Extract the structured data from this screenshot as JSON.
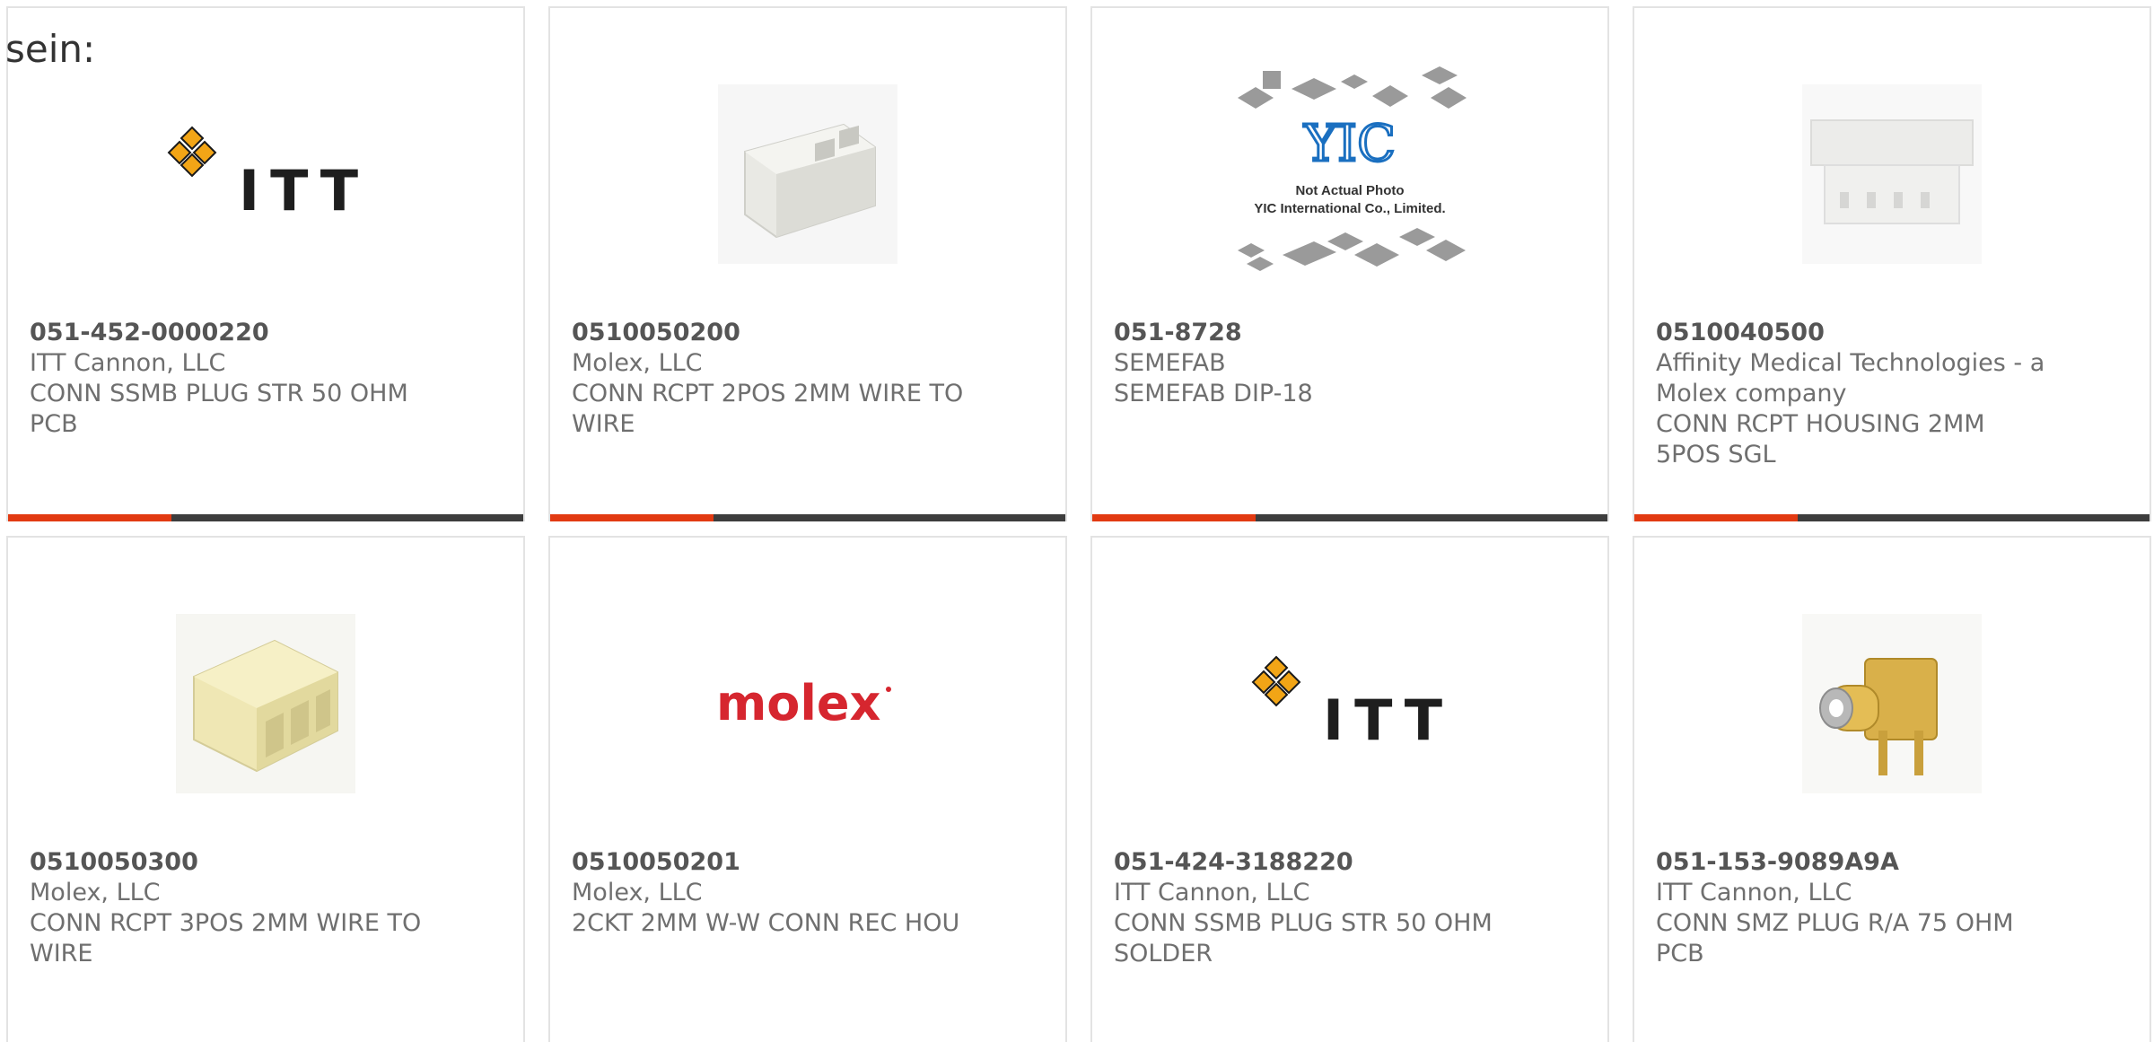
{
  "partial_text": "sein:",
  "products": [
    {
      "part_number": "051-452-0000220",
      "manufacturer": "ITT Cannon, LLC",
      "description": "CONN SSMB PLUG STR 50 OHM PCB",
      "image": "itt-logo"
    },
    {
      "part_number": "0510050200",
      "manufacturer": "Molex, LLC",
      "description": "CONN RCPT 2POS 2MM WIRE TO WIRE",
      "image": "white-2pos-connector-photo"
    },
    {
      "part_number": "051-8728",
      "manufacturer": "SEMEFAB",
      "description": "SEMEFAB DIP-18",
      "image": "yic-not-actual-photo",
      "image_text": [
        "YIC",
        "Not Actual Photo",
        "YIC International Co., Limited."
      ]
    },
    {
      "part_number": "0510040500",
      "manufacturer": "Affinity Medical Technologies - a Molex company",
      "description": "CONN RCPT HOUSING 2MM 5POS SGL",
      "image": "white-5pos-housing-photo"
    },
    {
      "part_number": "0510050300",
      "manufacturer": "Molex, LLC",
      "description": "CONN RCPT 3POS 2MM WIRE TO WIRE",
      "image": "cream-3pos-connector-photo"
    },
    {
      "part_number": "0510050201",
      "manufacturer": "Molex, LLC",
      "description": "2CKT 2MM W-W CONN REC HOU",
      "image": "molex-logo",
      "image_text": [
        "molex"
      ]
    },
    {
      "part_number": "051-424-3188220",
      "manufacturer": "ITT Cannon, LLC",
      "description": "CONN SSMB PLUG STR 50 OHM SOLDER",
      "image": "itt-logo"
    },
    {
      "part_number": "051-153-9089A9A",
      "manufacturer": "ITT Cannon, LLC",
      "description": "CONN SMZ PLUG R/A 75 OHM PCB",
      "image": "gold-rf-connector-photo"
    }
  ],
  "colors": {
    "accent": "#e23a12",
    "bar": "#3d3d3d",
    "itt_gold": "#f2a516",
    "molex_red": "#d6262f",
    "yic_blue": "#1a6fc0"
  }
}
